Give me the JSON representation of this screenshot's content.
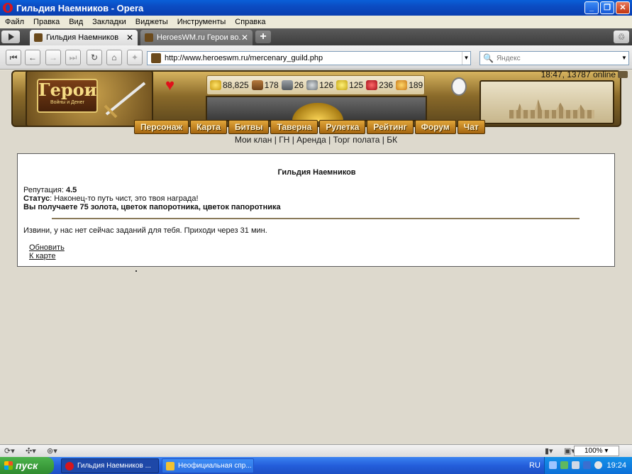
{
  "window": {
    "title": "Гильдия Наемников - Opera"
  },
  "menu": [
    "Файл",
    "Правка",
    "Вид",
    "Закладки",
    "Виджеты",
    "Инструменты",
    "Справка"
  ],
  "tabs": [
    {
      "label": "Гильдия Наемников",
      "active": true
    },
    {
      "label": "HeroesWM.ru Герои во...",
      "active": false
    }
  ],
  "address": {
    "url": "http://www.heroeswm.ru/mercenary_guild.php"
  },
  "search": {
    "placeholder": "Яндекс"
  },
  "game": {
    "logo_title": "Герои",
    "logo_subtitle": "Войны и Денег",
    "resources": [
      {
        "icon": "gold-icon",
        "value": "88,825"
      },
      {
        "icon": "wood-icon",
        "value": "178"
      },
      {
        "icon": "ore-icon",
        "value": "26"
      },
      {
        "icon": "mercury-icon",
        "value": "126"
      },
      {
        "icon": "sulfur-icon",
        "value": "125"
      },
      {
        "icon": "crystal-icon",
        "value": "236"
      },
      {
        "icon": "gems-icon",
        "value": "189"
      }
    ],
    "time_online": "18:47, 13787 online",
    "nav": [
      "Персонаж",
      "Карта",
      "Битвы",
      "Таверна",
      "Рулетка",
      "Рейтинг",
      "Форум",
      "Чат"
    ],
    "sublinks": [
      "Мои клан",
      "ГН",
      "Аренда",
      "Торг полата",
      "БК"
    ]
  },
  "guild": {
    "heading": "Гильдия Наемников",
    "reputation_label": "Репутация:",
    "reputation_value": "4.5",
    "status_label": "Статус",
    "status_text": ": Наконец-то путь чист, это твоя награда!",
    "reward_text": "Вы получаете 75 золота, цветок папоротника, цветок папоротника",
    "no_tasks": "Извини, у нас нет сейчас заданий для тебя. Приходи через 31 мин.",
    "refresh_link": "Обновить",
    "map_link": "К карте"
  },
  "statusbar": {
    "zoom": "100%"
  },
  "taskbar": {
    "start": "пуск",
    "buttons": [
      {
        "label": "Гильдия Наемников ...",
        "active": true
      },
      {
        "label": "Неофициальная спр...",
        "active": false
      }
    ],
    "lang": "RU",
    "clock": "19:24"
  },
  "colors": {
    "titlebar": "#0b4cc2",
    "nav_button": "#c17f1f",
    "page_bg": "#ddd9cd"
  }
}
